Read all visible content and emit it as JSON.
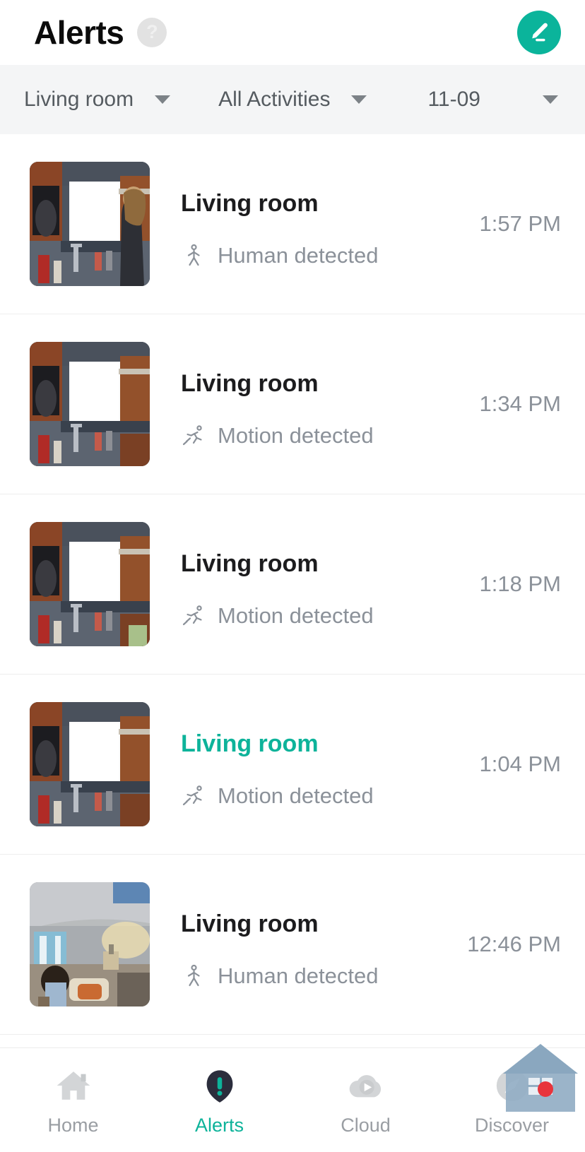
{
  "header": {
    "title": "Alerts",
    "help_icon": "help-question-icon",
    "help_glyph": "?",
    "edit_icon": "edit-pencil-icon",
    "accent_color": "#0bb49b"
  },
  "filters": [
    {
      "name": "camera",
      "value": "Living room",
      "caret": "chevron-down-icon"
    },
    {
      "name": "activity",
      "value": "All Activities",
      "caret": "chevron-down-icon"
    },
    {
      "name": "date",
      "value": "11-09",
      "caret": "chevron-down-icon"
    }
  ],
  "alerts": [
    {
      "location": "Living room",
      "event": "Human detected",
      "event_icon": "human-walking-icon",
      "time": "1:57 PM",
      "highlighted": false,
      "thumbnail": "kitchen-window-person"
    },
    {
      "location": "Living room",
      "event": "Motion detected",
      "event_icon": "motion-running-icon",
      "time": "1:34 PM",
      "highlighted": false,
      "thumbnail": "kitchen-window"
    },
    {
      "location": "Living room",
      "event": "Motion detected",
      "event_icon": "motion-running-icon",
      "time": "1:18 PM",
      "highlighted": false,
      "thumbnail": "kitchen-window"
    },
    {
      "location": "Living room",
      "event": "Motion detected",
      "event_icon": "motion-running-icon",
      "time": "1:04 PM",
      "highlighted": true,
      "thumbnail": "kitchen-window"
    },
    {
      "location": "Living room",
      "event": "Human detected",
      "event_icon": "human-walking-icon",
      "time": "12:46 PM",
      "highlighted": false,
      "thumbnail": "living-room-lamp"
    }
  ],
  "bottom_nav": {
    "items": [
      {
        "label": "Home",
        "icon": "home-icon",
        "active": false
      },
      {
        "label": "Alerts",
        "icon": "alert-bell-icon",
        "active": true
      },
      {
        "label": "Cloud",
        "icon": "cloud-play-icon",
        "active": false
      },
      {
        "label": "Discover",
        "icon": "discover-compass-icon",
        "active": false
      }
    ],
    "active_color": "#0db39a",
    "inactive_color": "#9a9ea3"
  }
}
